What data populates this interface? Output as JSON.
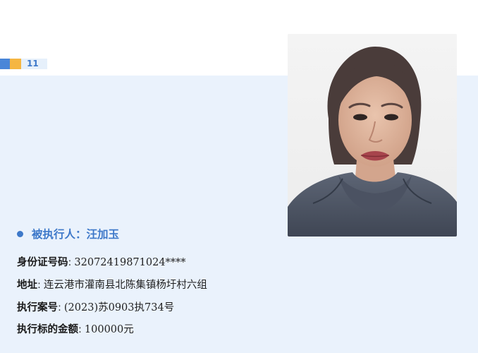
{
  "badge": {
    "number": "11",
    "colors": {
      "blue": "#4a86d8",
      "yellow": "#f5b642",
      "bg": "#e6f0fb"
    }
  },
  "person": {
    "name_label": "被执行人：",
    "name": "汪加玉",
    "photo_icon": "portrait-photo"
  },
  "fields": [
    {
      "label": "身份证号码",
      "sep": ":",
      "value": "32072419871024****"
    },
    {
      "label": "地址",
      "sep": ":",
      "value": "连云港市灌南县北陈集镇杨圩村六组"
    },
    {
      "label": "执行案号",
      "sep": ":",
      "value": "(2023)苏0903执734号"
    },
    {
      "label": "执行标的金额",
      "sep": ":",
      "value": "100000元"
    }
  ],
  "colors": {
    "accent": "#3d78c9",
    "panel_bg": "#eaf2fc"
  }
}
